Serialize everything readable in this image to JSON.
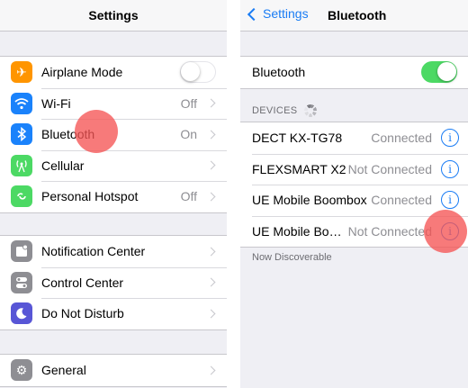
{
  "left": {
    "title": "Settings",
    "group1": [
      {
        "label": "Airplane Mode",
        "icon": "airplane-icon",
        "color": "#ff9500",
        "toggle": "off"
      },
      {
        "label": "Wi-Fi",
        "icon": "wifi-icon",
        "color": "#1a82fb",
        "value": "Off"
      },
      {
        "label": "Bluetooth",
        "icon": "bluetooth-icon",
        "color": "#1a82fb",
        "value": "On"
      },
      {
        "label": "Cellular",
        "icon": "cellular-icon",
        "color": "#4cd964",
        "value": ""
      },
      {
        "label": "Personal Hotspot",
        "icon": "hotspot-icon",
        "color": "#4cd964",
        "value": "Off"
      }
    ],
    "group2": [
      {
        "label": "Notification Center",
        "icon": "notification-center-icon",
        "color": "#8e8e93"
      },
      {
        "label": "Control Center",
        "icon": "control-center-icon",
        "color": "#8e8e93"
      },
      {
        "label": "Do Not Disturb",
        "icon": "moon-icon",
        "color": "#5856d6"
      }
    ],
    "group3": [
      {
        "label": "General",
        "icon": "gear-icon",
        "color": "#8e8e93"
      }
    ]
  },
  "right": {
    "back_label": "Settings",
    "title": "Bluetooth",
    "bluetooth_label": "Bluetooth",
    "bluetooth_toggle": "on",
    "devices_header": "DEVICES",
    "devices": [
      {
        "name": "DECT KX-TG78",
        "status": "Connected"
      },
      {
        "name": "FLEXSMART X2",
        "status": "Not Connected"
      },
      {
        "name": "UE Mobile Boombox",
        "status": "Connected"
      },
      {
        "name": "UE Mobile Bo…",
        "status": "Not Connected"
      }
    ],
    "footer": "Now Discoverable"
  },
  "colors": {
    "accent": "#1a7cf4",
    "toggle_on": "#4cd964",
    "tap_highlight": "#f55555"
  }
}
